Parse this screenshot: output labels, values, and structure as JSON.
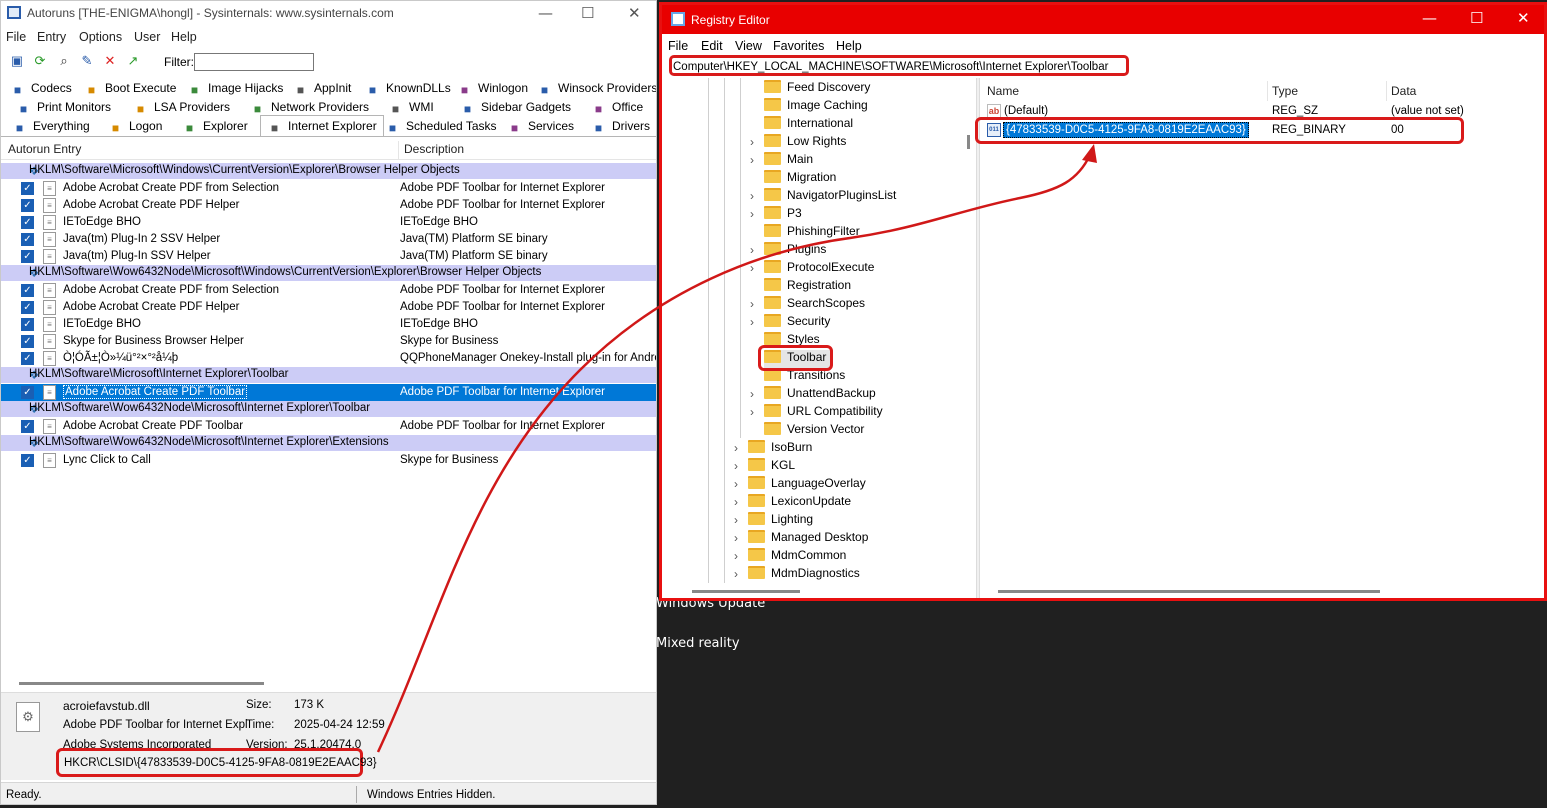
{
  "background": {
    "items": [
      "Windows Update",
      "Mixed reality"
    ]
  },
  "autoruns": {
    "title": "Autoruns [THE-ENIGMA\\hongl] - Sysinternals: www.sysinternals.com",
    "window_controls": [
      "—",
      "☐",
      "✕"
    ],
    "menu": [
      "File",
      "Entry",
      "Options",
      "User",
      "Help"
    ],
    "filter_label": "Filter:",
    "filter_value": "",
    "tabs_row1": [
      {
        "label": "Codecs",
        "icon": "codecs-icon"
      },
      {
        "label": "Boot Execute",
        "icon": "boot-execute-icon"
      },
      {
        "label": "Image Hijacks",
        "icon": "image-hijacks-icon"
      },
      {
        "label": "AppInit",
        "icon": "appinit-icon"
      },
      {
        "label": "KnownDLLs",
        "icon": "knowndlls-icon"
      },
      {
        "label": "Winlogon",
        "icon": "winlogon-icon"
      },
      {
        "label": "Winsock Providers",
        "icon": "winsock-icon"
      }
    ],
    "tabs_row2": [
      {
        "label": "Print Monitors",
        "icon": "printer-icon"
      },
      {
        "label": "LSA Providers",
        "icon": "shield-icon"
      },
      {
        "label": "Network Providers",
        "icon": "network-icon"
      },
      {
        "label": "WMI",
        "icon": "wmi-icon"
      },
      {
        "label": "Sidebar Gadgets",
        "icon": "gadget-icon"
      },
      {
        "label": "Office",
        "icon": "office-icon"
      }
    ],
    "tabs_row3": [
      {
        "label": "Everything",
        "icon": "everything-icon"
      },
      {
        "label": "Logon",
        "icon": "logon-icon"
      },
      {
        "label": "Explorer",
        "icon": "explorer-icon"
      },
      {
        "label": "Internet Explorer",
        "icon": "internet-explorer-icon"
      },
      {
        "label": "Scheduled Tasks",
        "icon": "scheduled-tasks-icon"
      },
      {
        "label": "Services",
        "icon": "services-icon"
      },
      {
        "label": "Drivers",
        "icon": "drivers-icon"
      }
    ],
    "columns": {
      "entry": "Autorun Entry",
      "description": "Description"
    },
    "groups": [
      {
        "key": "HKLM\\Software\\Microsoft\\Windows\\CurrentVersion\\Explorer\\Browser Helper Objects",
        "rows": [
          {
            "entry": "Adobe Acrobat Create PDF from Selection",
            "description": "Adobe PDF Toolbar for Internet Explorer"
          },
          {
            "entry": "Adobe Acrobat Create PDF Helper",
            "description": "Adobe PDF Toolbar for Internet Explorer"
          },
          {
            "entry": "IEToEdge BHO",
            "description": "IEToEdge BHO"
          },
          {
            "entry": "Java(tm) Plug-In 2 SSV Helper",
            "description": "Java(TM) Platform SE binary"
          },
          {
            "entry": "Java(tm) Plug-In SSV Helper",
            "description": "Java(TM) Platform SE binary"
          }
        ]
      },
      {
        "key": "HKLM\\Software\\Wow6432Node\\Microsoft\\Windows\\CurrentVersion\\Explorer\\Browser Helper Objects",
        "rows": [
          {
            "entry": "Adobe Acrobat Create PDF from Selection",
            "description": "Adobe PDF Toolbar for Internet Explorer"
          },
          {
            "entry": "Adobe Acrobat Create PDF Helper",
            "description": "Adobe PDF Toolbar for Internet Explorer"
          },
          {
            "entry": "IEToEdge BHO",
            "description": "IEToEdge BHO"
          },
          {
            "entry": "Skype for Business Browser Helper",
            "description": "Skype for Business"
          },
          {
            "entry": "Ò¦ÓÃ±¦Ò»¼ü°²×°²å¼þ",
            "description": "QQPhoneManager Onekey-Install plug-in for Android F"
          }
        ]
      },
      {
        "key": "HKLM\\Software\\Microsoft\\Internet Explorer\\Toolbar",
        "rows": [
          {
            "entry": "Adobe Acrobat Create PDF Toolbar",
            "description": "Adobe PDF Toolbar for Internet Explorer",
            "selected": true
          }
        ]
      },
      {
        "key": "HKLM\\Software\\Wow6432Node\\Microsoft\\Internet Explorer\\Toolbar",
        "rows": [
          {
            "entry": "Adobe Acrobat Create PDF Toolbar",
            "description": "Adobe PDF Toolbar for Internet Explorer"
          }
        ]
      },
      {
        "key": "HKLM\\Software\\Wow6432Node\\Microsoft\\Internet Explorer\\Extensions",
        "rows": [
          {
            "entry": "Lync Click to Call",
            "description": "Skype for Business"
          }
        ]
      }
    ],
    "details": {
      "file": "acroiefavstub.dll",
      "description": "Adobe PDF Toolbar for Internet Expl",
      "company": "Adobe Systems Incorporated",
      "size_label": "Size:",
      "size": "173 K",
      "time_label": "Time:",
      "time": "2025-04-24 12:59",
      "version_label": "Version:",
      "version": "25.1.20474.0",
      "clsid_path": "HKCR\\CLSID\\{47833539-D0C5-4125-9FA8-0819E2EAAC93}"
    },
    "status_left": "Ready.",
    "status_right": "Windows Entries Hidden."
  },
  "regedit": {
    "title": "Registry Editor",
    "window_controls": [
      "—",
      "☐",
      "✕"
    ],
    "menu": [
      "File",
      "Edit",
      "View",
      "Favorites",
      "Help"
    ],
    "address": "Computer\\HKEY_LOCAL_MACHINE\\SOFTWARE\\Microsoft\\Internet Explorer\\Toolbar",
    "tree": [
      {
        "label": "Feed Discovery",
        "level": 2,
        "chevron": false
      },
      {
        "label": "Image Caching",
        "level": 2,
        "chevron": false
      },
      {
        "label": "International",
        "level": 2,
        "chevron": false
      },
      {
        "label": "Low Rights",
        "level": 2,
        "chevron": true
      },
      {
        "label": "Main",
        "level": 2,
        "chevron": true
      },
      {
        "label": "Migration",
        "level": 2,
        "chevron": false
      },
      {
        "label": "NavigatorPluginsList",
        "level": 2,
        "chevron": true
      },
      {
        "label": "P3",
        "level": 2,
        "chevron": true
      },
      {
        "label": "PhishingFilter",
        "level": 2,
        "chevron": false
      },
      {
        "label": "Plugins",
        "level": 2,
        "chevron": true
      },
      {
        "label": "ProtocolExecute",
        "level": 2,
        "chevron": true
      },
      {
        "label": "Registration",
        "level": 2,
        "chevron": false
      },
      {
        "label": "SearchScopes",
        "level": 2,
        "chevron": true
      },
      {
        "label": "Security",
        "level": 2,
        "chevron": true
      },
      {
        "label": "Styles",
        "level": 2,
        "chevron": false
      },
      {
        "label": "Toolbar",
        "level": 2,
        "chevron": false,
        "selected": true
      },
      {
        "label": "Transitions",
        "level": 2,
        "chevron": false
      },
      {
        "label": "UnattendBackup",
        "level": 2,
        "chevron": true
      },
      {
        "label": "URL Compatibility",
        "level": 2,
        "chevron": true
      },
      {
        "label": "Version Vector",
        "level": 2,
        "chevron": false
      },
      {
        "label": "IsoBurn",
        "level": 1,
        "chevron": true
      },
      {
        "label": "KGL",
        "level": 1,
        "chevron": true
      },
      {
        "label": "LanguageOverlay",
        "level": 1,
        "chevron": true
      },
      {
        "label": "LexiconUpdate",
        "level": 1,
        "chevron": true
      },
      {
        "label": "Lighting",
        "level": 1,
        "chevron": true
      },
      {
        "label": "Managed Desktop",
        "level": 1,
        "chevron": true
      },
      {
        "label": "MdmCommon",
        "level": 1,
        "chevron": true
      },
      {
        "label": "MdmDiagnostics",
        "level": 1,
        "chevron": true
      }
    ],
    "columns": {
      "name": "Name",
      "type": "Type",
      "data": "Data"
    },
    "values": [
      {
        "name": "(Default)",
        "type": "REG_SZ",
        "data": "(value not set)",
        "icon": "ab"
      },
      {
        "name": "{47833539-D0C5-4125-9FA8-0819E2EAAC93}",
        "type": "REG_BINARY",
        "data": "00",
        "icon": "011",
        "selected": true
      }
    ]
  },
  "colors": {
    "highlight_red": "#d91a1a",
    "regedit_titlebar": "#e80000",
    "selection_blue": "#0078d7",
    "group_row": "#ccccf6"
  }
}
